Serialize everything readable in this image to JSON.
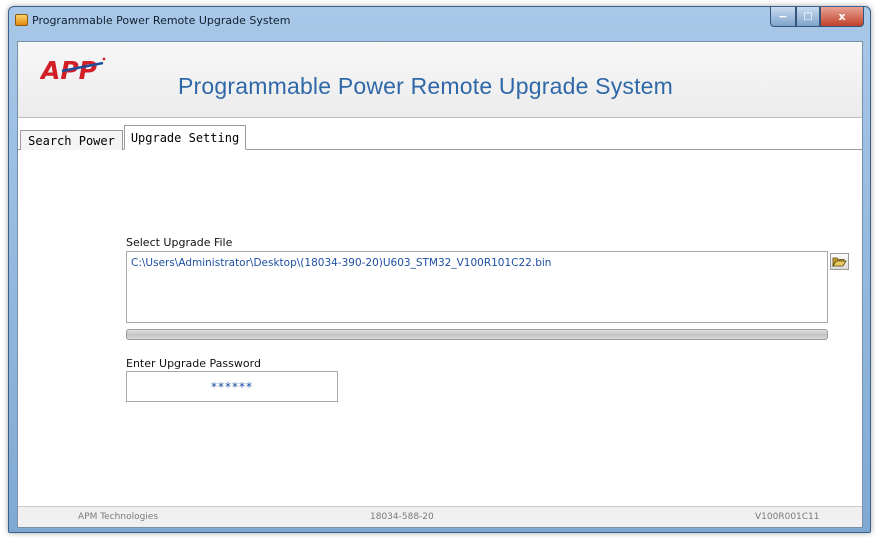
{
  "window": {
    "title": "Programmable Power Remote Upgrade System",
    "controls": {
      "minimize": "−",
      "maximize": "□",
      "close": "x"
    }
  },
  "header": {
    "logo_text": "APP",
    "title": "Programmable Power Remote Upgrade System"
  },
  "tabs": [
    {
      "label": "Search Power",
      "active": false
    },
    {
      "label": "Upgrade Setting",
      "active": true
    }
  ],
  "upgrade": {
    "file_label": "Select Upgrade File",
    "file_path": "C:\\Users\\Administrator\\Desktop\\(18034-390-20)U603_STM32_V100R101C22.bin",
    "browse_icon": "folder-open-icon",
    "progress": 0,
    "password_label": "Enter Upgrade Password",
    "password_value": "******"
  },
  "status": {
    "company": "APM Technologies",
    "model": "18034-588-20",
    "version": "V100R001C11"
  },
  "colors": {
    "title_blue": "#2f68a8",
    "value_blue": "#1d4fa3",
    "logo_red": "#d21f26",
    "logo_blue": "#1f4f9a"
  }
}
